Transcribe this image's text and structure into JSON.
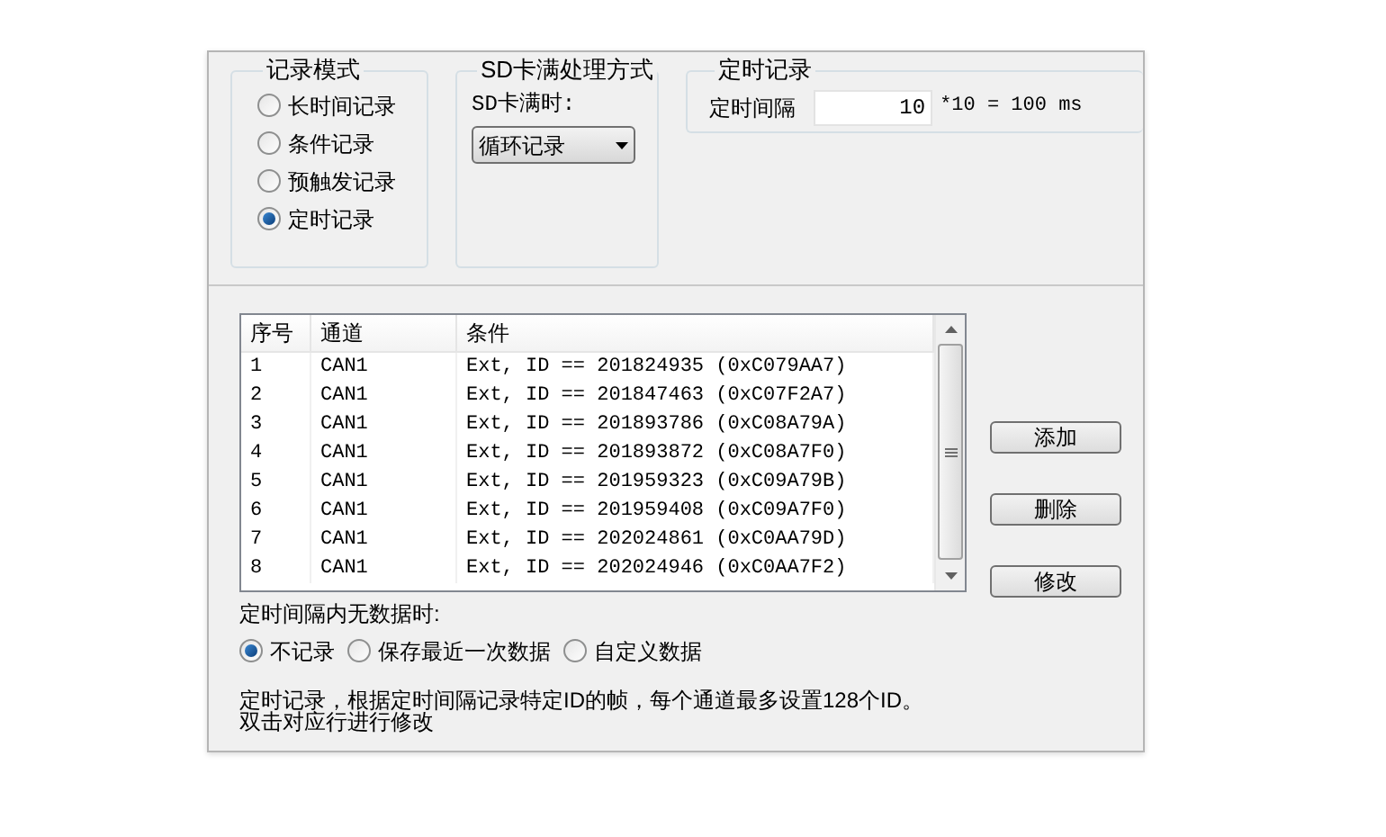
{
  "record_mode": {
    "title": "记录模式",
    "options": [
      {
        "label": "长时间记录",
        "selected": false
      },
      {
        "label": "条件记录",
        "selected": false
      },
      {
        "label": "预触发记录",
        "selected": false
      },
      {
        "label": "定时记录",
        "selected": true
      }
    ]
  },
  "sd_full": {
    "title": "SD卡满处理方式",
    "label": "SD卡满时:",
    "dropdown": {
      "value": "循环记录"
    }
  },
  "timed": {
    "title": "定时记录",
    "label": "定时间隔",
    "value": "10",
    "formula": "*10 = 100 ms"
  },
  "table": {
    "columns": [
      "序号",
      "通道",
      "条件"
    ],
    "rows": [
      [
        "1",
        "CAN1",
        "Ext, ID == 201824935 (0xC079AA7)"
      ],
      [
        "2",
        "CAN1",
        "Ext, ID == 201847463 (0xC07F2A7)"
      ],
      [
        "3",
        "CAN1",
        "Ext, ID == 201893786 (0xC08A79A)"
      ],
      [
        "4",
        "CAN1",
        "Ext, ID == 201893872 (0xC08A7F0)"
      ],
      [
        "5",
        "CAN1",
        "Ext, ID == 201959323 (0xC09A79B)"
      ],
      [
        "6",
        "CAN1",
        "Ext, ID == 201959408 (0xC09A7F0)"
      ],
      [
        "7",
        "CAN1",
        "Ext, ID == 202024861 (0xC0AA79D)"
      ],
      [
        "8",
        "CAN1",
        "Ext, ID == 202024946 (0xC0AA7F2)"
      ]
    ]
  },
  "buttons": [
    "添加",
    "删除",
    "修改"
  ],
  "no_data": {
    "label": "定时间隔内无数据时:",
    "options": [
      {
        "label": "不记录",
        "selected": true
      },
      {
        "label": "保存最近一次数据",
        "selected": false
      },
      {
        "label": "自定义数据",
        "selected": false
      }
    ]
  },
  "notes": [
    "定时记录，根据定时间隔记录特定ID的帧，每个通道最多设置128个ID。",
    "双击对应行进行修改"
  ]
}
